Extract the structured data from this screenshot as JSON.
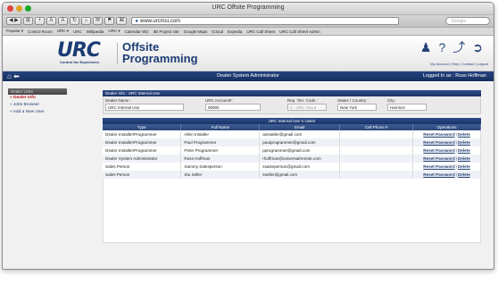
{
  "window": {
    "title": "URC Offsite Programming"
  },
  "toolbar": {
    "url": "www.urcmsi.com",
    "buttons": [
      "◀ ▶",
      "⊞",
      "+",
      "A",
      "A",
      "↻",
      "⌂",
      "✉",
      "⚑",
      "⌘"
    ],
    "search_placeholder": "Google"
  },
  "bookmarks": [
    "Popular ▾",
    "Control Room",
    "URC ▾",
    "URC",
    "Wikipedia",
    "URC ▾",
    "Calendar Wiz",
    "IBI Project site",
    "Google Maps",
    "iCloud",
    "Expedia",
    "URC Call Sheet",
    "URC Call Sheet Admin"
  ],
  "header": {
    "logo_text": "URC",
    "logo_tagline": "Control the Experience.",
    "title_line1": "Offsite",
    "title_line2": "Programming",
    "icons": [
      "person-icon",
      "help-icon",
      "wrench-icon",
      "logout-icon"
    ],
    "links": "My Account | Help | Contact | Logout"
  },
  "nav": {
    "role": "Dealer System Administrator",
    "user": "Logged In as : Russ Hoffman"
  },
  "sidebar": {
    "heading": "Dealer Links",
    "items": [
      {
        "label": "» Dealer Info",
        "active": true
      },
      {
        "label": "» Jobs Browser",
        "active": false
      },
      {
        "label": "» Add a New User",
        "active": false
      }
    ]
  },
  "dealer_form": {
    "heading": "Dealer Info : URC Internal Use",
    "fields": [
      {
        "label": "Dealer Name :",
        "value": "URC Internal Use"
      },
      {
        "label": "URC Account# :",
        "value": "00000"
      },
      {
        "label": "Rep. Terr. Code :",
        "value": "2 - URC Hou ▾"
      },
      {
        "label": "States / Country :",
        "value": "New York"
      },
      {
        "label": "City :",
        "value": "Harrison"
      }
    ]
  },
  "users_table": {
    "caption": "URC Internal Use 's Users",
    "columns": [
      "Type",
      "Full Name",
      "Email",
      "Cell Phone #",
      "Operations"
    ],
    "rows": [
      [
        "Dealer Installer/Programmer",
        "Allen Installer",
        "ainstaller@gmail.com",
        ""
      ],
      [
        "Dealer Installer/Programmer",
        "Paul Programmer",
        "paulprogrammer@gmail.com",
        ""
      ],
      [
        "Dealer Installer/Programmer",
        "Peter Programmer",
        "pprogrammer@gmail.com",
        ""
      ],
      [
        "Dealer System Administrator",
        "Russ Hoffman",
        "rhoffman@universalremote.com",
        ""
      ],
      [
        "Sales Person",
        "Sammy Salesperson",
        "ssalesperson@gmail.com",
        ""
      ],
      [
        "Sales Person",
        "Stu Seller",
        "sseller@gmail.com",
        ""
      ]
    ],
    "op_reset": "Reset Password",
    "op_delete": "Delete"
  },
  "colors": {
    "brand_navy": "#1c3c74",
    "nav_bar": "#1b3466",
    "active_link": "#c0131a"
  }
}
